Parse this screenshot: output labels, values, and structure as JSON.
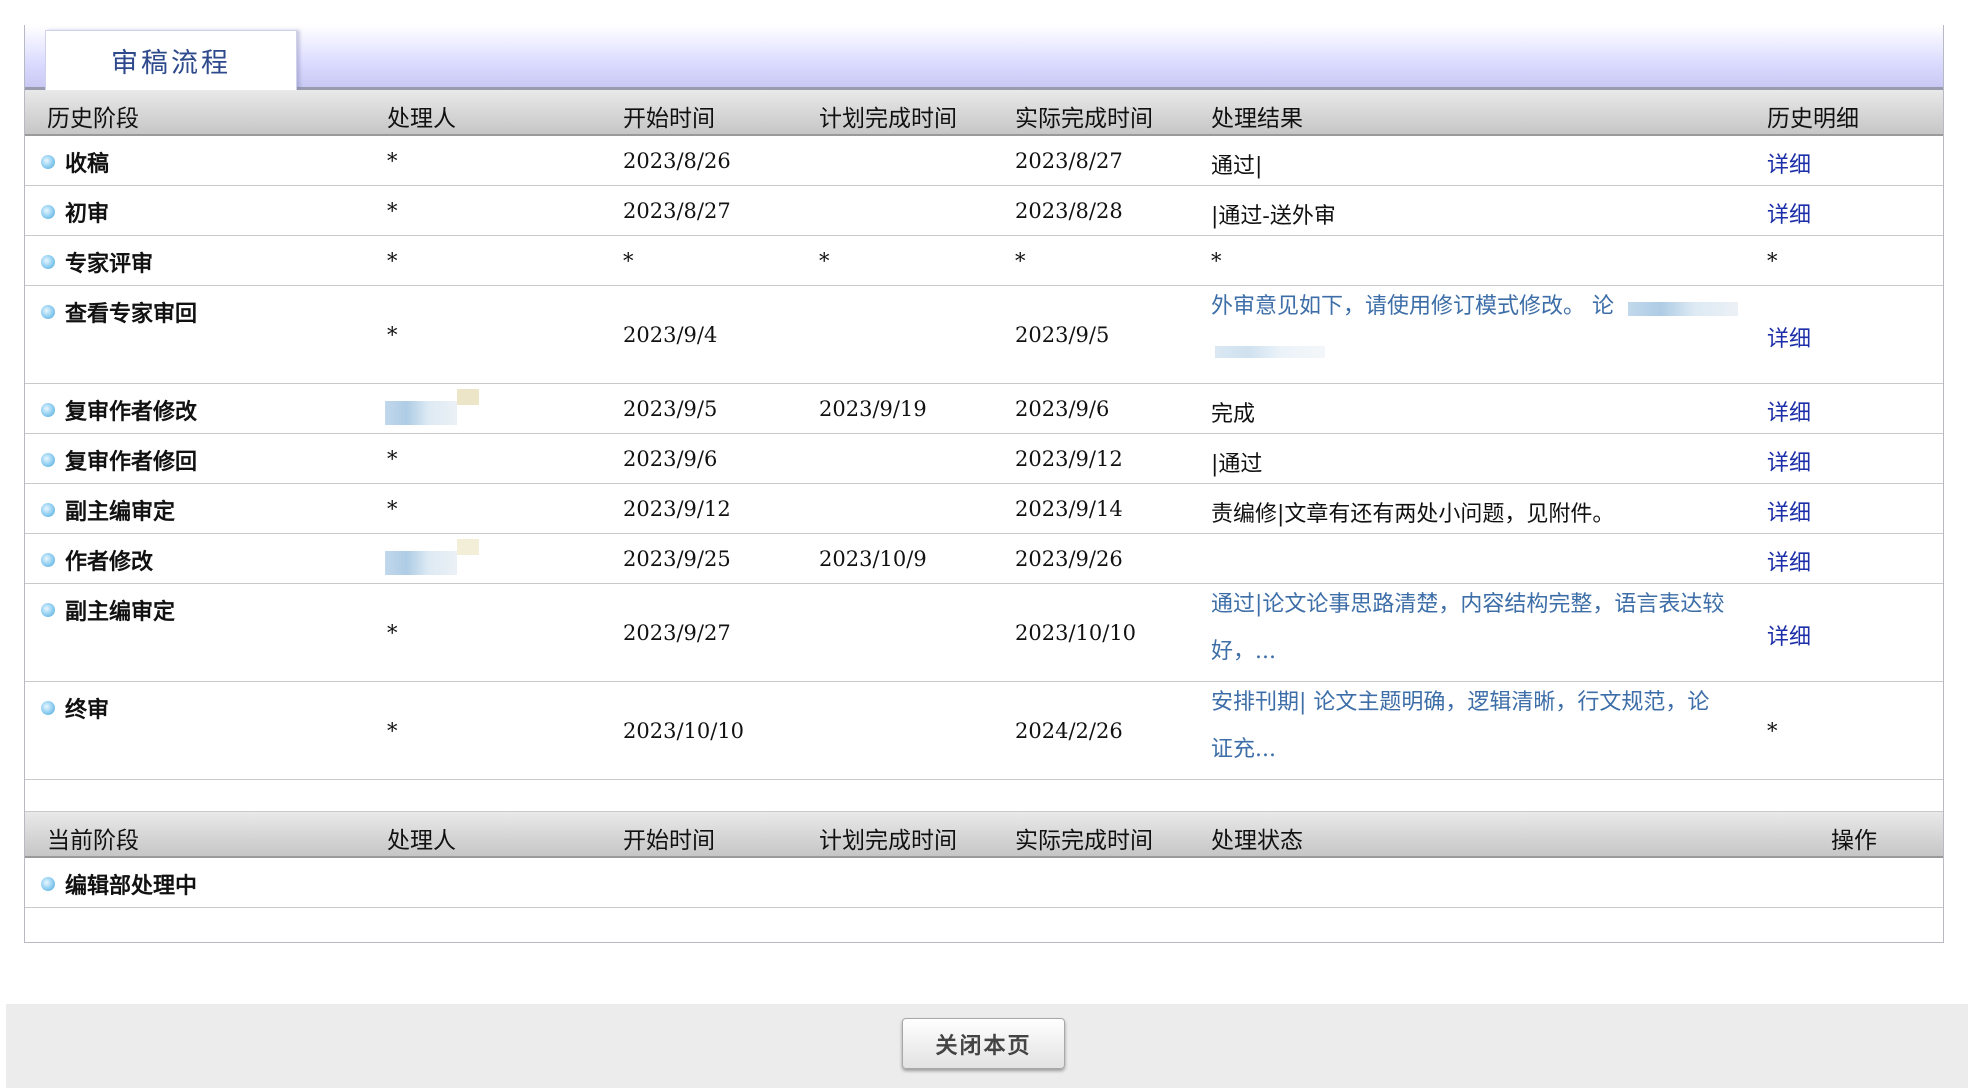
{
  "tab": {
    "title": "审稿流程"
  },
  "history_headers": {
    "stage": "历史阶段",
    "handler": "处理人",
    "start": "开始时间",
    "planned": "计划完成时间",
    "actual": "实际完成时间",
    "result": "处理结果",
    "detail": "历史明细"
  },
  "history_rows": [
    {
      "stage": "收稿",
      "handler": "*",
      "start": "2023/8/26",
      "planned": "",
      "actual": "2023/8/27",
      "result": "通过|",
      "detail": "详细"
    },
    {
      "stage": "初审",
      "handler": "*",
      "start": "2023/8/27",
      "planned": "",
      "actual": "2023/8/28",
      "result": "|通过-送外审",
      "detail": "详细"
    },
    {
      "stage": "专家评审",
      "handler": "*",
      "start": "*",
      "planned": "*",
      "actual": "*",
      "result": "*",
      "detail": "*"
    },
    {
      "stage": "查看专家审回",
      "handler": "*",
      "start": "2023/9/4",
      "planned": "",
      "actual": "2023/9/5",
      "result": "外审意见如下，请使用修订模式修改。 论",
      "detail": "详细"
    },
    {
      "stage": "复审作者修改",
      "handler": "",
      "start": "2023/9/5",
      "planned": "2023/9/19",
      "actual": "2023/9/6",
      "result": "完成",
      "detail": "详细"
    },
    {
      "stage": "复审作者修回",
      "handler": "*",
      "start": "2023/9/6",
      "planned": "",
      "actual": "2023/9/12",
      "result": "|通过",
      "detail": "详细"
    },
    {
      "stage": "副主编审定",
      "handler": "*",
      "start": "2023/9/12",
      "planned": "",
      "actual": "2023/9/14",
      "result": "责编修|文章有还有两处小问题，见附件。",
      "detail": "详细"
    },
    {
      "stage": "作者修改",
      "handler": "",
      "start": "2023/9/25",
      "planned": "2023/10/9",
      "actual": "2023/9/26",
      "result": "",
      "detail": "详细"
    },
    {
      "stage": "副主编审定",
      "handler": "*",
      "start": "2023/9/27",
      "planned": "",
      "actual": "2023/10/10",
      "result": "通过|论文论事思路清楚，内容结构完整，语言表达较好，...",
      "detail": "详细"
    },
    {
      "stage": "终审",
      "handler": "*",
      "start": "2023/10/10",
      "planned": "",
      "actual": "2024/2/26",
      "result": "安排刊期| 论文主题明确，逻辑清晰，行文规范，论证充...",
      "detail": "*"
    }
  ],
  "current_headers": {
    "stage": "当前阶段",
    "handler": "处理人",
    "start": "开始时间",
    "planned": "计划完成时间",
    "actual": "实际完成时间",
    "status": "处理状态",
    "operation": "操作"
  },
  "current_rows": [
    {
      "stage": "编辑部处理中"
    }
  ],
  "footer": {
    "close_label": "关闭本页"
  }
}
